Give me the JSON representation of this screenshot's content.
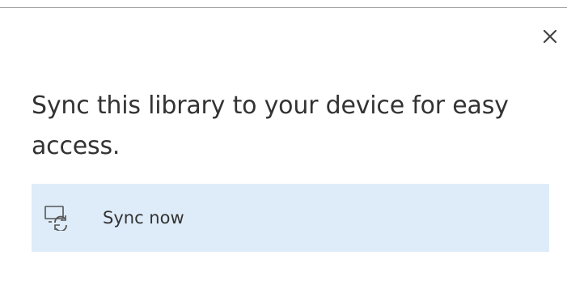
{
  "dialog": {
    "message": "Sync this library to your device for easy access.",
    "close_icon": "close-icon",
    "action": {
      "label": "Sync now",
      "icon": "sync-device-icon"
    }
  },
  "colors": {
    "panel_background": "#deecf9",
    "text": "#333333",
    "divider": "#9a9a9a"
  }
}
